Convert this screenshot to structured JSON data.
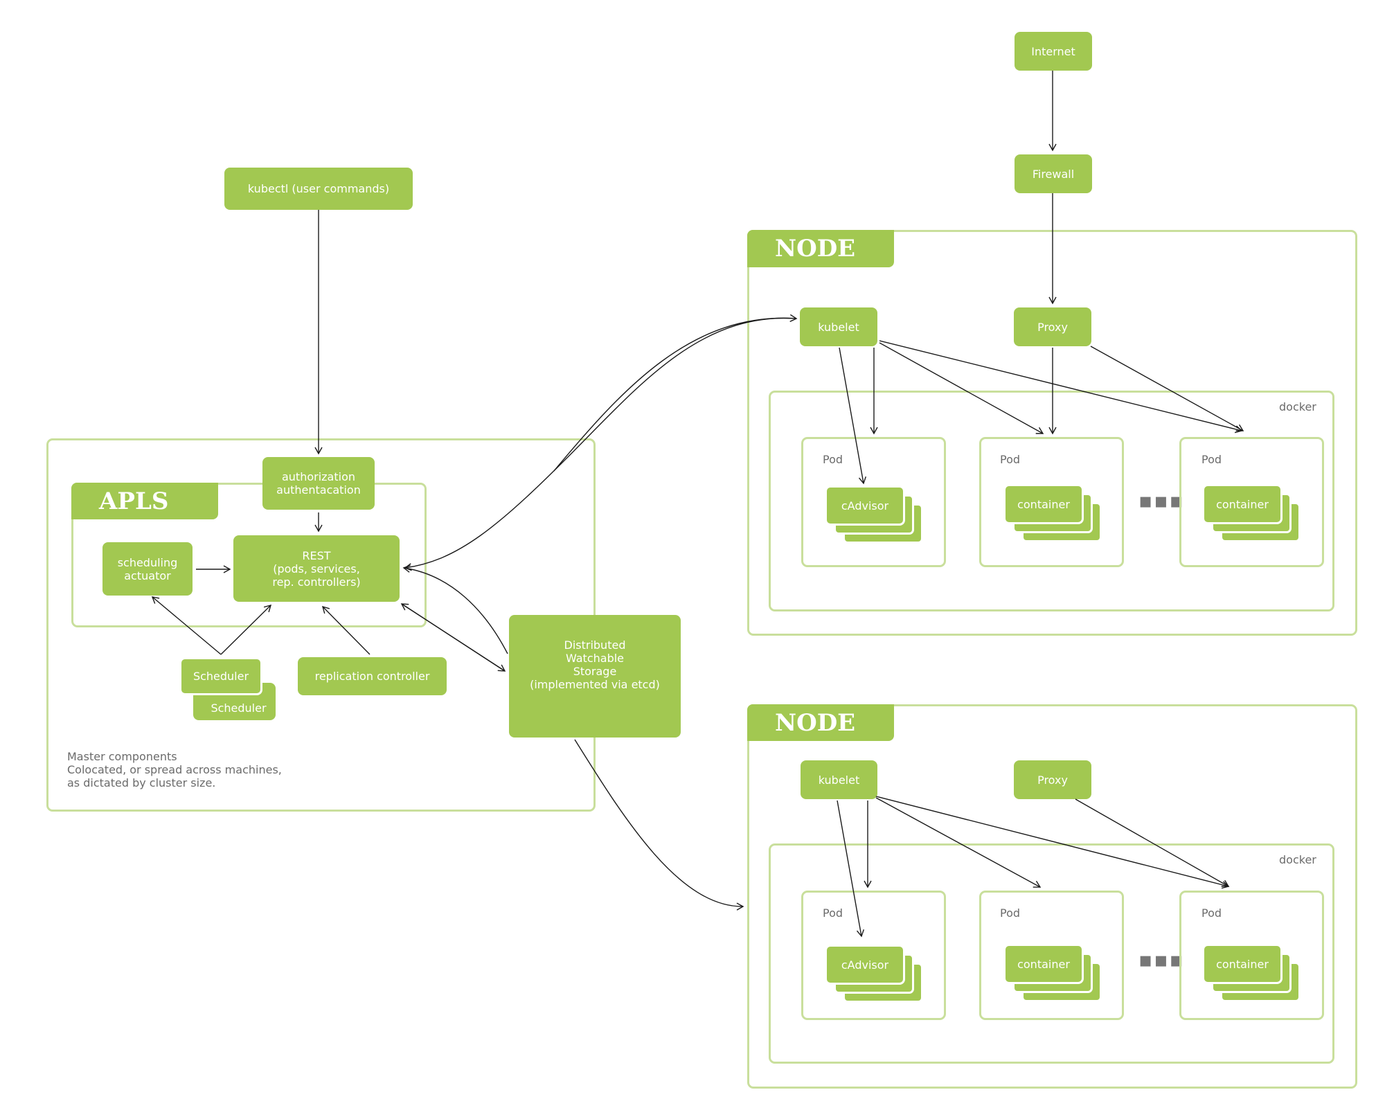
{
  "diagram": {
    "top": {
      "kubectl": "kubectl (user commands)",
      "internet": "Internet",
      "firewall": "Firewall"
    },
    "master": {
      "apls_title": "APLS",
      "auth": "authorization\nauthentacation",
      "rest": "REST\n(pods, services,\nrep. controllers)",
      "scheduling_actuator": "scheduling\nactuator",
      "scheduler_front": "Scheduler",
      "scheduler_back": "Scheduler",
      "replication_controller": "replication controller",
      "note_line1": "Master components",
      "note_line2": "Colocated, or spread across machines,",
      "note_line3": "as dictated by cluster size."
    },
    "storage": "Distributed\nWatchable\nStorage\n(implemented via etcd)",
    "nodes": [
      {
        "title": "NODE",
        "kubelet": "kubelet",
        "proxy": "Proxy",
        "docker": "docker",
        "pods": [
          {
            "label": "Pod",
            "card": "cAdvisor"
          },
          {
            "label": "Pod",
            "card": "container"
          },
          {
            "label": "Pod",
            "card": "container"
          }
        ],
        "ellipsis": "▪▪▪"
      },
      {
        "title": "NODE",
        "kubelet": "kubelet",
        "proxy": "Proxy",
        "docker": "docker",
        "pods": [
          {
            "label": "Pod",
            "card": "cAdvisor"
          },
          {
            "label": "Pod",
            "card": "container"
          },
          {
            "label": "Pod",
            "card": "container"
          }
        ],
        "ellipsis": "▪▪▪"
      }
    ],
    "colors": {
      "fill_green": "#a2c851",
      "frame_green": "#c9df9c",
      "arrow": "#1a1a1a",
      "gray_text": "#6b6b6b"
    }
  }
}
